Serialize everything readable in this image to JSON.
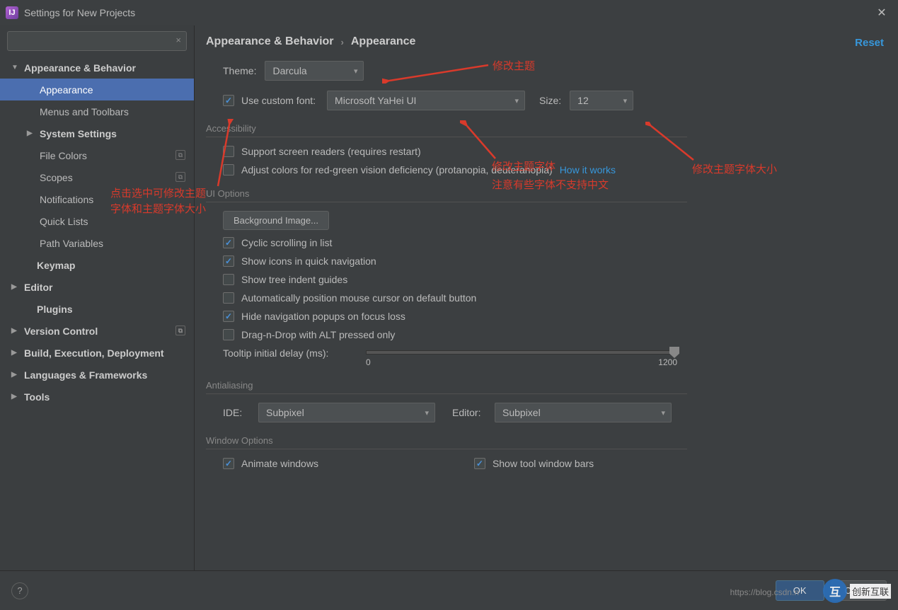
{
  "window": {
    "title": "Settings for New Projects"
  },
  "sidebar": {
    "items": [
      {
        "label": "Appearance & Behavior",
        "level": "lvl1",
        "arrow": "▼"
      },
      {
        "label": "Appearance",
        "level": "lvl2",
        "selected": true
      },
      {
        "label": "Menus and Toolbars",
        "level": "lvl2"
      },
      {
        "label": "System Settings",
        "level": "lvl2b",
        "arrow": "▶"
      },
      {
        "label": "File Colors",
        "level": "lvl2",
        "badge": "▣"
      },
      {
        "label": "Scopes",
        "level": "lvl2",
        "badge": "▣"
      },
      {
        "label": "Notifications",
        "level": "lvl2"
      },
      {
        "label": "Quick Lists",
        "level": "lvl2"
      },
      {
        "label": "Path Variables",
        "level": "lvl2"
      },
      {
        "label": "Keymap",
        "level": "lvl1 noarrow"
      },
      {
        "label": "Editor",
        "level": "lvl1",
        "arrow": "▶"
      },
      {
        "label": "Plugins",
        "level": "lvl1 noarrow"
      },
      {
        "label": "Version Control",
        "level": "lvl1",
        "arrow": "▶",
        "badge": "▣"
      },
      {
        "label": "Build, Execution, Deployment",
        "level": "lvl1",
        "arrow": "▶"
      },
      {
        "label": "Languages & Frameworks",
        "level": "lvl1",
        "arrow": "▶"
      },
      {
        "label": "Tools",
        "level": "lvl1",
        "arrow": "▶"
      }
    ]
  },
  "breadcrumb": {
    "root": "Appearance & Behavior",
    "current": "Appearance"
  },
  "reset": "Reset",
  "theme": {
    "label": "Theme:",
    "value": "Darcula"
  },
  "customFont": {
    "checked": true,
    "label": "Use custom font:",
    "value": "Microsoft YaHei UI",
    "sizeLabel": "Size:",
    "sizeValue": "12"
  },
  "sections": {
    "accessibility": {
      "title": "Accessibility",
      "screenReaders": {
        "checked": false,
        "label": "Support screen readers (requires restart)"
      },
      "adjustColors": {
        "checked": false,
        "label": "Adjust colors for red-green vision deficiency (protanopia, deuteranopia)",
        "link": "How it works"
      }
    },
    "uiOptions": {
      "title": "UI Options",
      "bgImage": "Background Image...",
      "opts": [
        {
          "c": true,
          "l": "Cyclic scrolling in list"
        },
        {
          "c": true,
          "l": "Show icons in quick navigation"
        },
        {
          "c": false,
          "l": "Show tree indent guides"
        },
        {
          "c": false,
          "l": "Automatically position mouse cursor on default button"
        },
        {
          "c": true,
          "l": "Hide navigation popups on focus loss"
        },
        {
          "c": false,
          "l": "Drag-n-Drop with ALT pressed only"
        }
      ],
      "tooltipLabel": "Tooltip initial delay (ms):",
      "tooltipMin": "0",
      "tooltipMax": "1200"
    },
    "antialiasing": {
      "title": "Antialiasing",
      "ideLabel": "IDE:",
      "ideValue": "Subpixel",
      "editorLabel": "Editor:",
      "editorValue": "Subpixel"
    },
    "windowOptions": {
      "title": "Window Options",
      "left": {
        "c": true,
        "l": "Animate windows"
      },
      "right": {
        "c": true,
        "l": "Show tool window bars"
      }
    }
  },
  "footer": {
    "ok": "OK",
    "cancel": "Cancel"
  },
  "annotations": {
    "a1": "修改主题",
    "a2": "修改主题字体",
    "a2b": "注意有些字体不支持中文",
    "a3": "修改主题字体大小",
    "a4": "点击选中可修改主题",
    "a4b": "字体和主题字体大小"
  },
  "watermark": {
    "url": "https://blog.csdn.n",
    "brand": "创新互联"
  }
}
